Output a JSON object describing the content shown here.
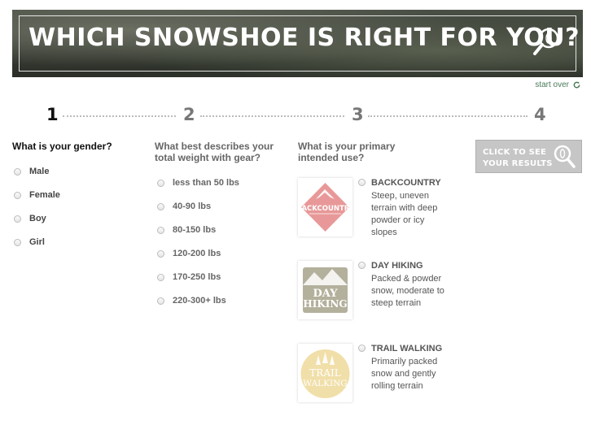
{
  "header": {
    "title": "WHICH SNOWSHOE IS RIGHT FOR YOU?",
    "icon": "snowshoe-search-icon"
  },
  "start_over": {
    "label": "start over",
    "icon": "refresh-icon"
  },
  "steps": [
    "1",
    "2",
    "3",
    "4"
  ],
  "step1": {
    "question": "What is your gender?",
    "options": [
      "Male",
      "Female",
      "Boy",
      "Girl"
    ]
  },
  "step2": {
    "question_line1": "What best describes your",
    "question_line2": "total weight with gear?",
    "options": [
      "less than 50 lbs",
      "40-90 lbs",
      "80-150 lbs",
      "120-200 lbs",
      "170-250 lbs",
      "220-300+ lbs"
    ]
  },
  "step3": {
    "question_line1": "What is your primary",
    "question_line2": "intended use?",
    "uses": [
      {
        "title": "BACKCOUNTRY",
        "desc": "Steep, uneven terrain with deep powder or icy slopes",
        "badge": "BACKCOUNTRY",
        "color": "#e89898"
      },
      {
        "title": "DAY HIKING",
        "desc": "Packed & powder snow, moderate to steep terrain",
        "badge_line1": "DAY",
        "badge_line2": "HIKING",
        "color": "#b3b09c"
      },
      {
        "title": "TRAIL WALKING",
        "desc": "Primarily packed snow and gently rolling terrain",
        "badge_line1": "TRAIL",
        "badge_line2": "WALKING",
        "color": "#f1dfa9"
      }
    ]
  },
  "step4": {
    "cta_line1": "CLICK TO SEE",
    "cta_line2": "YOUR RESULTS",
    "icon": "search-icon"
  }
}
